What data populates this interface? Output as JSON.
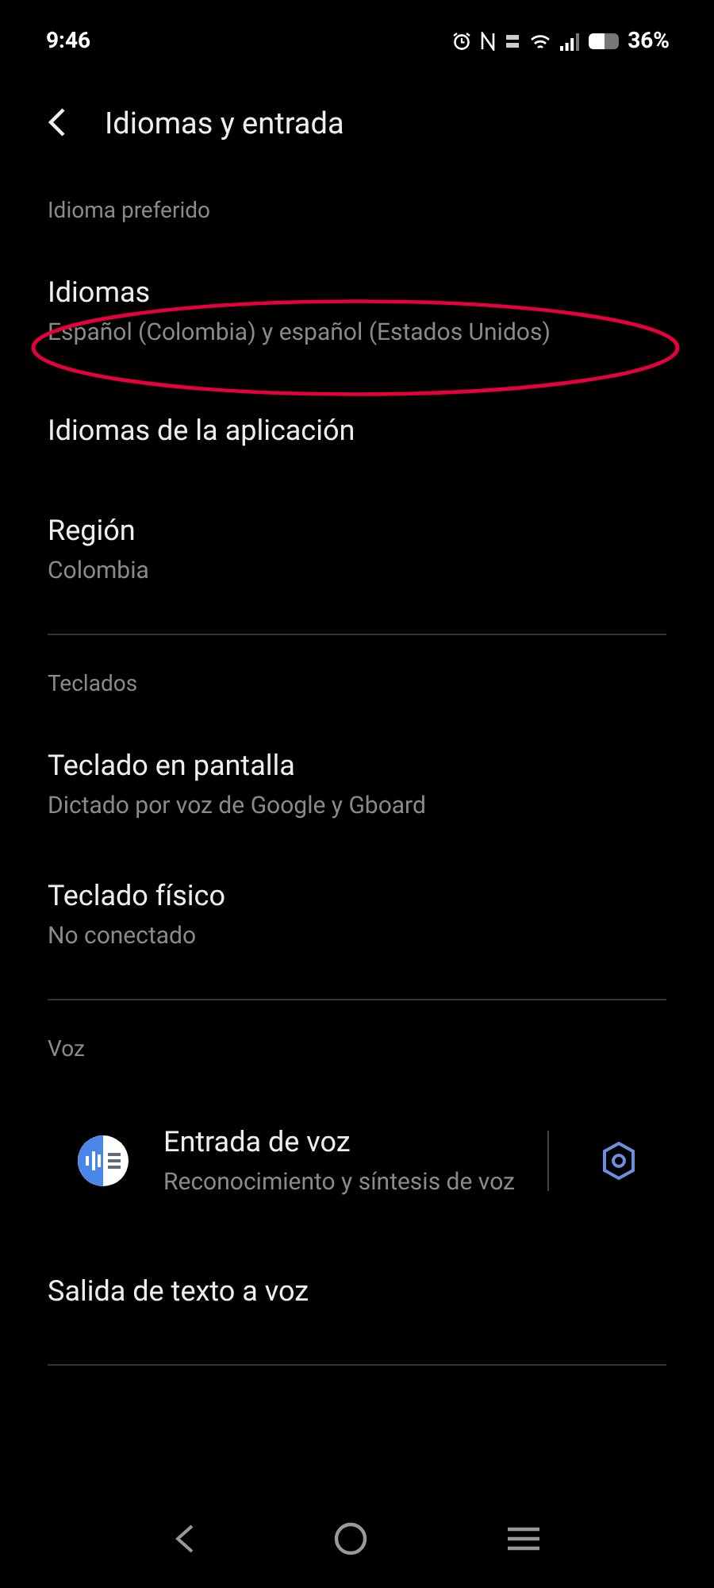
{
  "status_bar": {
    "time": "9:46",
    "battery_text": "36%"
  },
  "header": {
    "title": "Idiomas y entrada"
  },
  "sections": [
    {
      "title": "Idioma preferido",
      "items": [
        {
          "kind": "plain",
          "title": "Idiomas",
          "subtitle": "Español (Colombia) y español (Estados Unidos)",
          "circled": true
        },
        {
          "kind": "plain",
          "title": "Idiomas de la aplicación"
        },
        {
          "kind": "plain",
          "title": "Región",
          "subtitle": "Colombia"
        }
      ]
    },
    {
      "title": "Teclados",
      "items": [
        {
          "kind": "plain",
          "title": "Teclado en pantalla",
          "subtitle": "Dictado por voz de Google y Gboard"
        },
        {
          "kind": "plain",
          "title": "Teclado físico",
          "subtitle": "No conectado"
        }
      ]
    },
    {
      "title": "Voz",
      "items": [
        {
          "kind": "app",
          "title": "Entrada de voz",
          "subtitle": "Reconocimiento y síntesis de voz"
        },
        {
          "kind": "plain",
          "title": "Salida de texto a voz"
        }
      ]
    }
  ]
}
